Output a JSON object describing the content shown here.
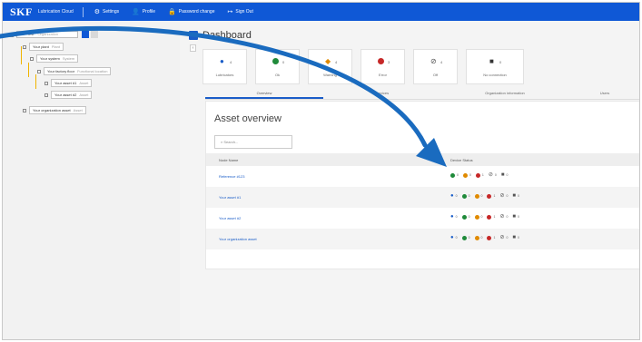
{
  "topbar": {
    "logo": "SKF",
    "app_name": "Lubrication Cloud",
    "nav": [
      {
        "icon": "⚙",
        "label": "Settings"
      },
      {
        "icon": "👤",
        "label": "Profile"
      },
      {
        "icon": "🔒",
        "label": "Password change"
      },
      {
        "icon": "↦",
        "label": "Sign Out"
      }
    ]
  },
  "tree": {
    "filter_value": "Val - Test",
    "filter_meta": "Organization",
    "nodes": [
      {
        "label": "Your plant",
        "meta": "Plant"
      },
      {
        "label": "Your system",
        "meta": "System"
      },
      {
        "label": "Your factory floor",
        "meta": "Functional location"
      },
      {
        "label": "Your asset #1",
        "meta": "Asset"
      },
      {
        "label": "Your asset #2",
        "meta": "Asset"
      },
      {
        "label": "Your organization asset",
        "meta": "Asset"
      }
    ]
  },
  "dashboard": {
    "title": "Dashboard",
    "collapse": "‹",
    "cards": [
      {
        "icon": "person-icon",
        "count": "4",
        "label": "Lubricators",
        "color": "#1a5dc8"
      },
      {
        "icon": "ok-icon",
        "count": "0",
        "label": "Ok",
        "color": "#1f8a3a"
      },
      {
        "icon": "warning-icon",
        "count": "4",
        "label": "Warning",
        "color": "#e08a00"
      },
      {
        "icon": "error-icon",
        "count": "3",
        "label": "Error",
        "color": "#c62828"
      },
      {
        "icon": "off-icon",
        "count": "4",
        "label": "Off",
        "color": "#555555"
      },
      {
        "icon": "no-connection-icon",
        "count": "0",
        "label": "No connection",
        "color": "#333333"
      }
    ],
    "tabs": [
      "Overview",
      "Devices",
      "Organization information",
      "Users"
    ],
    "active_tab": "Overview"
  },
  "asset_overview": {
    "title": "Asset overview",
    "search_placeholder": "Search...",
    "columns": [
      "Node Name",
      "Device Status"
    ],
    "rows": [
      {
        "name": "Reference #123",
        "counts": [
          "0",
          "0",
          "1",
          "0",
          "0"
        ]
      },
      {
        "name": "Your asset #1",
        "counts": [
          "0",
          "0",
          "0",
          "1",
          "0",
          "0"
        ]
      },
      {
        "name": "Your asset #2",
        "counts": [
          "0",
          "0",
          "0",
          "1",
          "0",
          "0"
        ]
      },
      {
        "name": "Your organization asset",
        "counts": [
          "0",
          "0",
          "0",
          "1",
          "0",
          "0"
        ]
      }
    ]
  }
}
